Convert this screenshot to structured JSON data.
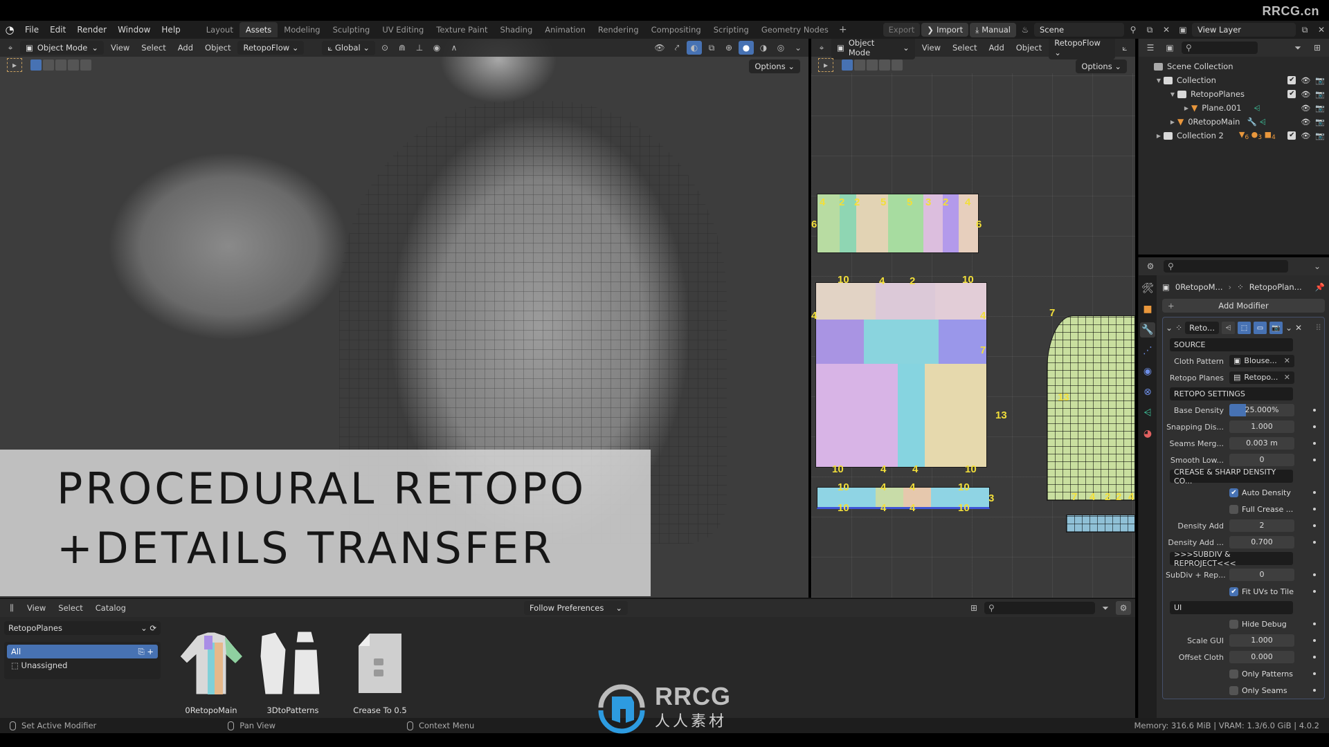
{
  "watermark": "RRCG.cn",
  "menubar": {
    "menus": [
      "File",
      "Edit",
      "Render",
      "Window",
      "Help"
    ],
    "workspaces": [
      "Layout",
      "Assets",
      "Modeling",
      "Sculpting",
      "UV Editing",
      "Texture Paint",
      "Shading",
      "Animation",
      "Rendering",
      "Compositing",
      "Scripting",
      "Geometry Nodes"
    ],
    "active_workspace": "Assets",
    "export_label": "Export",
    "import_label": "Import",
    "manual_label": "Manual",
    "scene": "Scene",
    "view_layer": "View Layer"
  },
  "viewport3d": {
    "mode": "Object Mode",
    "menus": [
      "View",
      "Select",
      "Add",
      "Object"
    ],
    "addon_menu": "RetopoFlow",
    "orientation": "Global",
    "options_label": "Options",
    "overlay_title_line1": "PROCEDURAL RETOPO",
    "overlay_title_line2": "+DETAILS TRANSFER"
  },
  "uv_editor": {
    "mode": "Object Mode",
    "menus": [
      "View",
      "Select",
      "Add",
      "Object"
    ],
    "addon_menu": "RetopoFlow",
    "options_label": "Options",
    "labels_top_strip": [
      "4",
      "2",
      "2",
      "5",
      "5",
      "3",
      "2",
      "4",
      "6",
      "6"
    ],
    "labels_body": [
      "10",
      "2",
      "2",
      "4",
      "4",
      "2",
      "2",
      "10",
      "4",
      "4",
      "7",
      "13",
      "10",
      "4",
      "4",
      "10"
    ],
    "labels_band": [
      "10",
      "4",
      "4",
      "10",
      "10",
      "4",
      "4",
      "10",
      "3"
    ],
    "labels_sleeve": [
      "7",
      "13",
      "7",
      "4",
      "2",
      "2",
      "4"
    ]
  },
  "outliner": {
    "rows": [
      {
        "label": "Scene Collection",
        "type": "scene"
      },
      {
        "label": "Collection",
        "type": "collection",
        "checked": true
      },
      {
        "label": "RetopoPlanes",
        "type": "collection",
        "checked": true
      },
      {
        "label": "Plane.001",
        "type": "object"
      },
      {
        "label": "0RetopoMain",
        "type": "object"
      },
      {
        "label": "Collection 2",
        "type": "collection",
        "checked": true,
        "badges": [
          "6",
          "3",
          "4"
        ]
      }
    ]
  },
  "properties": {
    "breadcrumb_object": "0RetopoM...",
    "breadcrumb_modifier": "RetopoPlan...",
    "add_modifier_label": "Add Modifier",
    "modifier_name": "Reto...",
    "sections": {
      "source": "SOURCE",
      "retopo_settings": "RETOPO SETTINGS",
      "crease": "CREASE & SHARP DENSITY CO...",
      "subdiv": ">>>SUBDIV & REPROJECT<<<",
      "ui": "UI"
    },
    "cloth_pattern": {
      "label": "Cloth Pattern",
      "value": "Blouse..."
    },
    "retopo_planes": {
      "label": "Retopo Planes",
      "value": "Retopo..."
    },
    "base_density": {
      "label": "Base Density",
      "value": "25.000%",
      "fraction": 0.25
    },
    "snapping_dist": {
      "label": "Snapping Dis...",
      "value": "1.000"
    },
    "seams_merge": {
      "label": "Seams Merg...",
      "value": "0.003 m"
    },
    "smooth_low": {
      "label": "Smooth Low...",
      "value": "0"
    },
    "auto_density": {
      "label": "Auto Density",
      "checked": true
    },
    "full_crease": {
      "label": "Full Crease ...",
      "checked": false
    },
    "density_add": {
      "label": "Density Add",
      "value": "2"
    },
    "density_add2": {
      "label": "Density Add ...",
      "value": "0.700"
    },
    "subdiv_reproject": {
      "label": "SubDiv + Rep...",
      "value": "0"
    },
    "fit_uvs": {
      "label": "Fit UVs to Tile",
      "checked": true
    },
    "hide_debug": {
      "label": "Hide Debug",
      "checked": false
    },
    "scale_gui": {
      "label": "Scale GUI",
      "value": "1.000"
    },
    "offset_cloth": {
      "label": "Offset Cloth",
      "value": "0.000"
    },
    "only_patterns": {
      "label": "Only Patterns",
      "checked": false
    },
    "only_seams": {
      "label": "Only Seams",
      "checked": false
    }
  },
  "asset_browser": {
    "menus": [
      "View",
      "Select",
      "Catalog"
    ],
    "import_method": "Follow Preferences",
    "library": "RetopoPlanes",
    "catalogs": [
      "All",
      "Unassigned"
    ],
    "assets": [
      "0RetopoMain",
      "3DtoPatterns",
      "Crease To 0.5"
    ]
  },
  "statusbar": {
    "hints": [
      "Set Active Modifier",
      "Pan View",
      "Context Menu"
    ],
    "info": "Memory: 316.6 MiB | VRAM: 1.3/6.0 GiB | 4.0.2"
  },
  "logo": {
    "brand": "RRCG",
    "sub": "人人素材"
  },
  "colors": {
    "accent": "#4772b3",
    "uv_label": "#f2df3a",
    "object_icon": "#e9973c"
  }
}
